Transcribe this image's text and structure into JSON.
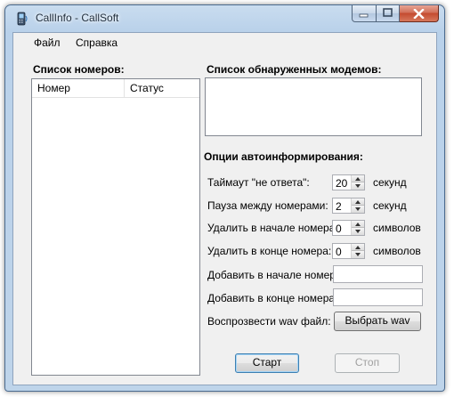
{
  "window": {
    "title": "CallInfo - CallSoft",
    "icon": "phone-app-icon",
    "controls": [
      "minimize-icon",
      "maximize-icon",
      "close-icon"
    ]
  },
  "menu": {
    "file": "Файл",
    "help": "Справка"
  },
  "numbers": {
    "label": "Список номеров:",
    "columns": [
      "Номер",
      "Статус"
    ],
    "rows": []
  },
  "modems": {
    "label": "Список обнаруженных модемов:",
    "items": []
  },
  "options": {
    "label": "Опции автоинформирования:",
    "timeout": {
      "label": "Таймаут \"не ответа\":",
      "value": "20",
      "unit": "секунд"
    },
    "pause": {
      "label": "Пауза между номерами:",
      "value": "2",
      "unit": "секунд"
    },
    "strip_start": {
      "label": "Удалить в начале номера:",
      "value": "0",
      "unit": "символов"
    },
    "strip_end": {
      "label": "Удалить в конце номера:",
      "value": "0",
      "unit": "символов"
    },
    "add_start": {
      "label": "Добавить в начале номера:",
      "value": ""
    },
    "add_end": {
      "label": "Добавить в конце номера:",
      "value": ""
    },
    "play_wav": {
      "label": "Воспрозвести wav файл:",
      "button": "Выбрать wav"
    }
  },
  "actions": {
    "start": "Старт",
    "stop": "Стоп"
  },
  "colors": {
    "frame": "#b9d1ea",
    "client": "#f0f0f0",
    "close_button": "#c44a2f"
  }
}
